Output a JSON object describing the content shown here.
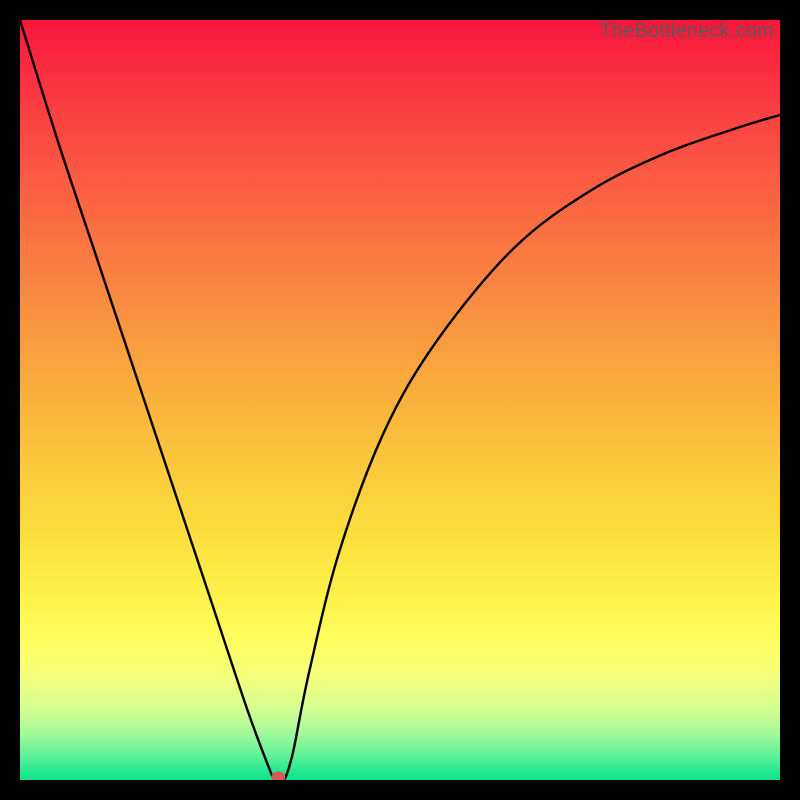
{
  "watermark": "TheBottleneck.com",
  "chart_data": {
    "type": "line",
    "title": "",
    "xlabel": "",
    "ylabel": "",
    "xlim": [
      0,
      100
    ],
    "ylim": [
      0,
      100
    ],
    "series": [
      {
        "name": "bottleneck-curve",
        "x": [
          0,
          5,
          10,
          15,
          20,
          25,
          30,
          33,
          33.5,
          34,
          34.5,
          35,
          36,
          38,
          42,
          48,
          55,
          65,
          75,
          85,
          95,
          100
        ],
        "values": [
          100,
          84,
          69,
          54,
          39,
          24,
          9,
          1,
          0.2,
          0,
          0.2,
          0.5,
          4,
          14,
          30,
          46,
          58,
          70,
          77.5,
          82.5,
          86,
          87.5
        ]
      }
    ],
    "marker": {
      "x": 34,
      "y": 0,
      "color": "#d95a52"
    },
    "background_gradient": {
      "stops": [
        {
          "offset": 0.0,
          "color": "#f9153b"
        },
        {
          "offset": 0.07,
          "color": "#fa2f41"
        },
        {
          "offset": 0.17,
          "color": "#fb4f43"
        },
        {
          "offset": 0.27,
          "color": "#fa6e42"
        },
        {
          "offset": 0.37,
          "color": "#f98c40"
        },
        {
          "offset": 0.47,
          "color": "#f9a93d"
        },
        {
          "offset": 0.57,
          "color": "#f9c43c"
        },
        {
          "offset": 0.67,
          "color": "#fbdd3e"
        },
        {
          "offset": 0.76,
          "color": "#fef24a"
        },
        {
          "offset": 0.82,
          "color": "#feff62"
        },
        {
          "offset": 0.87,
          "color": "#f2ff7f"
        },
        {
          "offset": 0.91,
          "color": "#d0fd92"
        },
        {
          "offset": 0.94,
          "color": "#a0f99a"
        },
        {
          "offset": 0.965,
          "color": "#66f29a"
        },
        {
          "offset": 0.985,
          "color": "#2fe992"
        },
        {
          "offset": 1.0,
          "color": "#0be48c"
        }
      ]
    }
  }
}
